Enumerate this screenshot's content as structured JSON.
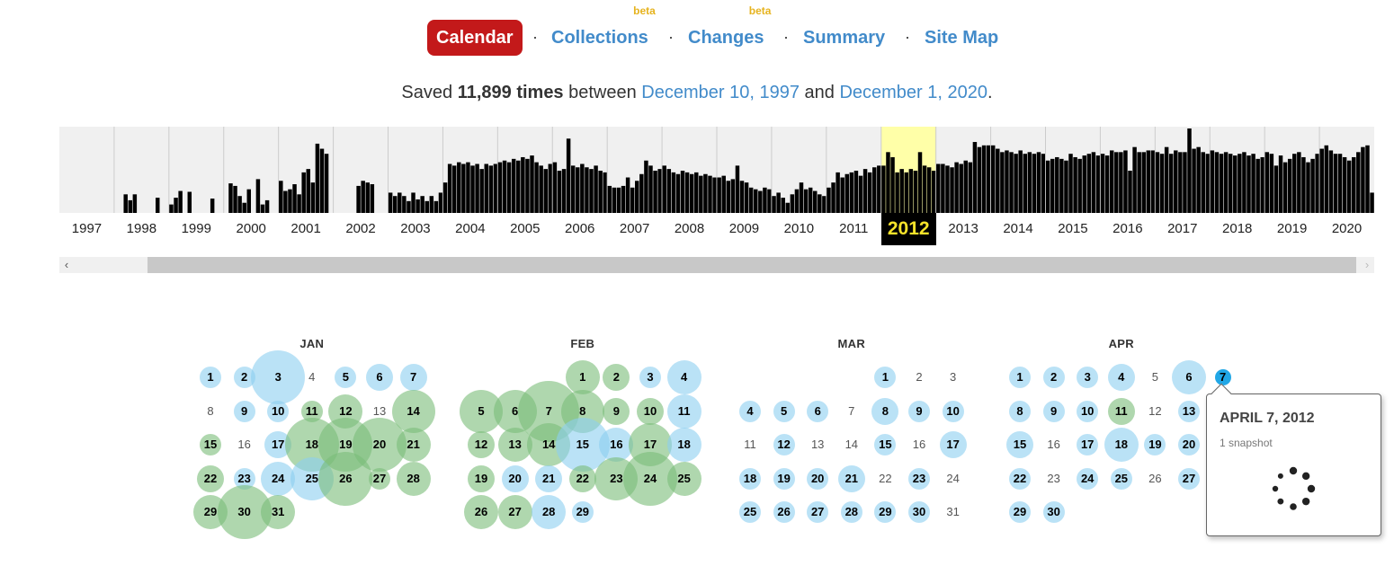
{
  "nav": {
    "calendar": "Calendar",
    "collections": "Collections",
    "collections_badge": "beta",
    "changes": "Changes",
    "changes_badge": "beta",
    "summary": "Summary",
    "sitemap": "Site Map",
    "separator": "·"
  },
  "saved": {
    "prefix": "Saved ",
    "count": "11,899 times",
    "between": " between ",
    "start": "December 10, 1997",
    "and": " and ",
    "end": "December 1, 2020",
    "suffix": "."
  },
  "timeline": {
    "selected_year": "2012",
    "years": [
      "1997",
      "1998",
      "1999",
      "2000",
      "2001",
      "2002",
      "2003",
      "2004",
      "2005",
      "2006",
      "2007",
      "2008",
      "2009",
      "2010",
      "2011",
      "2012",
      "2013",
      "2014",
      "2015",
      "2016",
      "2017",
      "2018",
      "2019",
      "2020"
    ],
    "monthly_levels": [
      [
        0,
        0,
        0,
        0,
        0,
        0,
        0,
        0,
        0,
        0,
        0,
        0
      ],
      [
        0,
        0,
        0.22,
        0.15,
        0.22,
        0,
        0,
        0,
        0,
        0.18,
        0,
        0
      ],
      [
        0.1,
        0.18,
        0.26,
        0,
        0.25,
        0,
        0,
        0,
        0,
        0.17,
        0,
        0
      ],
      [
        0,
        0.35,
        0.32,
        0.2,
        0.12,
        0.28,
        0,
        0.4,
        0.1,
        0.15,
        0,
        0
      ],
      [
        0.38,
        0.26,
        0.28,
        0.34,
        0.22,
        0.48,
        0.52,
        0.36,
        0.82,
        0.76,
        0.7,
        0
      ],
      [
        0,
        0,
        0,
        0,
        0,
        0.32,
        0.38,
        0.36,
        0.34,
        0,
        0,
        0
      ],
      [
        0.24,
        0.2,
        0.24,
        0.2,
        0.14,
        0.24,
        0.16,
        0.2,
        0.14,
        0.2,
        0.14,
        0.24
      ],
      [
        0.36,
        0.58,
        0.56,
        0.6,
        0.58,
        0.6,
        0.56,
        0.58,
        0.52,
        0.58,
        0.56,
        0.58
      ],
      [
        0.6,
        0.62,
        0.6,
        0.64,
        0.62,
        0.66,
        0.64,
        0.68,
        0.6,
        0.56,
        0.52,
        0.58
      ],
      [
        0.6,
        0.5,
        0.52,
        0.88,
        0.56,
        0.54,
        0.58,
        0.54,
        0.52,
        0.56,
        0.5,
        0.48
      ],
      [
        0.32,
        0.3,
        0.3,
        0.32,
        0.42,
        0.3,
        0.38,
        0.46,
        0.62,
        0.56,
        0.5,
        0.52
      ],
      [
        0.56,
        0.52,
        0.48,
        0.46,
        0.5,
        0.48,
        0.46,
        0.48,
        0.44,
        0.46,
        0.44,
        0.42
      ],
      [
        0.42,
        0.44,
        0.38,
        0.4,
        0.56,
        0.38,
        0.36,
        0.3,
        0.28,
        0.26,
        0.3,
        0.28
      ],
      [
        0.2,
        0.24,
        0.18,
        0.12,
        0.22,
        0.28,
        0.36,
        0.28,
        0.3,
        0.26,
        0.22,
        0.2
      ],
      [
        0.3,
        0.36,
        0.48,
        0.42,
        0.46,
        0.48,
        0.5,
        0.44,
        0.52,
        0.48,
        0.54,
        0.56
      ],
      [
        0.56,
        0.72,
        0.66,
        0.48,
        0.52,
        0.48,
        0.52,
        0.5,
        0.72,
        0.56,
        0.54,
        0.5
      ],
      [
        0.58,
        0.58,
        0.56,
        0.54,
        0.6,
        0.58,
        0.62,
        0.6,
        0.84,
        0.78,
        0.8,
        0.8
      ],
      [
        0.8,
        0.76,
        0.72,
        0.74,
        0.72,
        0.7,
        0.74,
        0.7,
        0.72,
        0.7,
        0.72,
        0.7
      ],
      [
        0.62,
        0.64,
        0.66,
        0.64,
        0.62,
        0.7,
        0.66,
        0.64,
        0.68,
        0.7,
        0.72,
        0.68
      ],
      [
        0.7,
        0.68,
        0.74,
        0.72,
        0.72,
        0.74,
        0.5,
        0.78,
        0.72,
        0.72,
        0.74,
        0.74
      ],
      [
        0.72,
        0.7,
        0.78,
        0.7,
        0.74,
        0.72,
        0.72,
        1.0,
        0.76,
        0.78,
        0.72,
        0.7
      ],
      [
        0.74,
        0.72,
        0.7,
        0.72,
        0.7,
        0.68,
        0.7,
        0.72,
        0.68,
        0.7,
        0.64,
        0.66
      ],
      [
        0.72,
        0.7,
        0.56,
        0.68,
        0.6,
        0.64,
        0.7,
        0.72,
        0.66,
        0.6,
        0.64,
        0.7
      ],
      [
        0.76,
        0.8,
        0.74,
        0.7,
        0.7,
        0.66,
        0.62,
        0.66,
        0.72,
        0.78,
        0.8,
        0.24
      ]
    ]
  },
  "scroll": {
    "left_arrow": "‹",
    "right_arrow": "›"
  },
  "calendar": {
    "months": [
      {
        "name": "JAN",
        "first_weekday": 0,
        "days_in_month": 31,
        "captures": {
          "1": [
            1,
            "b"
          ],
          "2": [
            1,
            "b"
          ],
          "3": [
            5,
            "b"
          ],
          "5": [
            1,
            "b"
          ],
          "6": [
            2,
            "b"
          ],
          "7": [
            2,
            "b"
          ],
          "9": [
            1,
            "b"
          ],
          "10": [
            1,
            "b"
          ],
          "11": [
            1,
            "g"
          ],
          "12": [
            3,
            "g"
          ],
          "14": [
            4,
            "g"
          ],
          "15": [
            1,
            "g"
          ],
          "17": [
            2,
            "b"
          ],
          "18": [
            5,
            "g"
          ],
          "19": [
            5,
            "g"
          ],
          "20": [
            5,
            "g"
          ],
          "21": [
            3,
            "g"
          ],
          "22": [
            2,
            "g"
          ],
          "23": [
            1,
            "b"
          ],
          "24": [
            3,
            "b"
          ],
          "25": [
            4,
            "b"
          ],
          "26": [
            5,
            "g"
          ],
          "27": [
            1,
            "g"
          ],
          "28": [
            3,
            "g"
          ],
          "29": [
            3,
            "g"
          ],
          "30": [
            5,
            "g"
          ],
          "31": [
            3,
            "g"
          ]
        }
      },
      {
        "name": "FEB",
        "first_weekday": 3,
        "days_in_month": 29,
        "captures": {
          "1": [
            3,
            "g"
          ],
          "2": [
            2,
            "g"
          ],
          "3": [
            1,
            "b"
          ],
          "4": [
            3,
            "b"
          ],
          "5": [
            4,
            "g"
          ],
          "6": [
            4,
            "g"
          ],
          "7": [
            6,
            "g"
          ],
          "8": [
            4,
            "g"
          ],
          "9": [
            2,
            "g"
          ],
          "10": [
            2,
            "g"
          ],
          "11": [
            3,
            "b"
          ],
          "12": [
            2,
            "g"
          ],
          "13": [
            3,
            "g"
          ],
          "14": [
            4,
            "g"
          ],
          "15": [
            5,
            "b"
          ],
          "16": [
            3,
            "b"
          ],
          "17": [
            4,
            "g"
          ],
          "18": [
            3,
            "b"
          ],
          "19": [
            2,
            "g"
          ],
          "20": [
            2,
            "b"
          ],
          "21": [
            2,
            "b"
          ],
          "22": [
            2,
            "g"
          ],
          "23": [
            4,
            "g"
          ],
          "24": [
            5,
            "g"
          ],
          "25": [
            3,
            "g"
          ],
          "26": [
            3,
            "g"
          ],
          "27": [
            3,
            "g"
          ],
          "28": [
            3,
            "b"
          ],
          "29": [
            1,
            "b"
          ]
        }
      },
      {
        "name": "MAR",
        "first_weekday": 4,
        "days_in_month": 31,
        "captures": {
          "1": [
            1,
            "b"
          ],
          "4": [
            1,
            "b"
          ],
          "5": [
            1,
            "b"
          ],
          "6": [
            1,
            "b"
          ],
          "8": [
            2,
            "b"
          ],
          "9": [
            1,
            "b"
          ],
          "10": [
            1,
            "b"
          ],
          "12": [
            1,
            "b"
          ],
          "15": [
            1,
            "b"
          ],
          "17": [
            2,
            "b"
          ],
          "18": [
            1,
            "b"
          ],
          "19": [
            1,
            "b"
          ],
          "20": [
            1,
            "b"
          ],
          "21": [
            2,
            "b"
          ],
          "23": [
            1,
            "b"
          ],
          "25": [
            1,
            "b"
          ],
          "26": [
            1,
            "b"
          ],
          "27": [
            1,
            "b"
          ],
          "28": [
            1,
            "b"
          ],
          "29": [
            1,
            "b"
          ],
          "30": [
            1,
            "b"
          ]
        }
      },
      {
        "name": "APR",
        "first_weekday": 0,
        "days_in_month": 30,
        "captures": {
          "1": [
            1,
            "b"
          ],
          "2": [
            1,
            "b"
          ],
          "3": [
            1,
            "b"
          ],
          "4": [
            2,
            "b"
          ],
          "6": [
            3,
            "b"
          ],
          "7": [
            0,
            "sel"
          ],
          "8": [
            1,
            "b"
          ],
          "9": [
            1,
            "b"
          ],
          "10": [
            1,
            "b"
          ],
          "11": [
            2,
            "g"
          ],
          "13": [
            1,
            "b"
          ],
          "15": [
            2,
            "b"
          ],
          "17": [
            1,
            "b"
          ],
          "18": [
            3,
            "b"
          ],
          "19": [
            1,
            "b"
          ],
          "20": [
            1,
            "b"
          ],
          "22": [
            1,
            "b"
          ],
          "24": [
            1,
            "b"
          ],
          "25": [
            1,
            "b"
          ],
          "27": [
            1,
            "b"
          ],
          "29": [
            1,
            "b"
          ],
          "30": [
            1,
            "b"
          ]
        }
      }
    ]
  },
  "tooltip": {
    "date": "APRIL 7, 2012",
    "count": "1 snapshot"
  },
  "colors": {
    "calendar_active": "#c3191a",
    "link": "#428bca",
    "beta": "#e6b31e",
    "selected_year_text": "#f7e32a",
    "selected_year_band": "#ffffa8",
    "circle_green": "#7abc78",
    "circle_blue": "#8ccef0",
    "selected_day": "#21a7e6"
  }
}
